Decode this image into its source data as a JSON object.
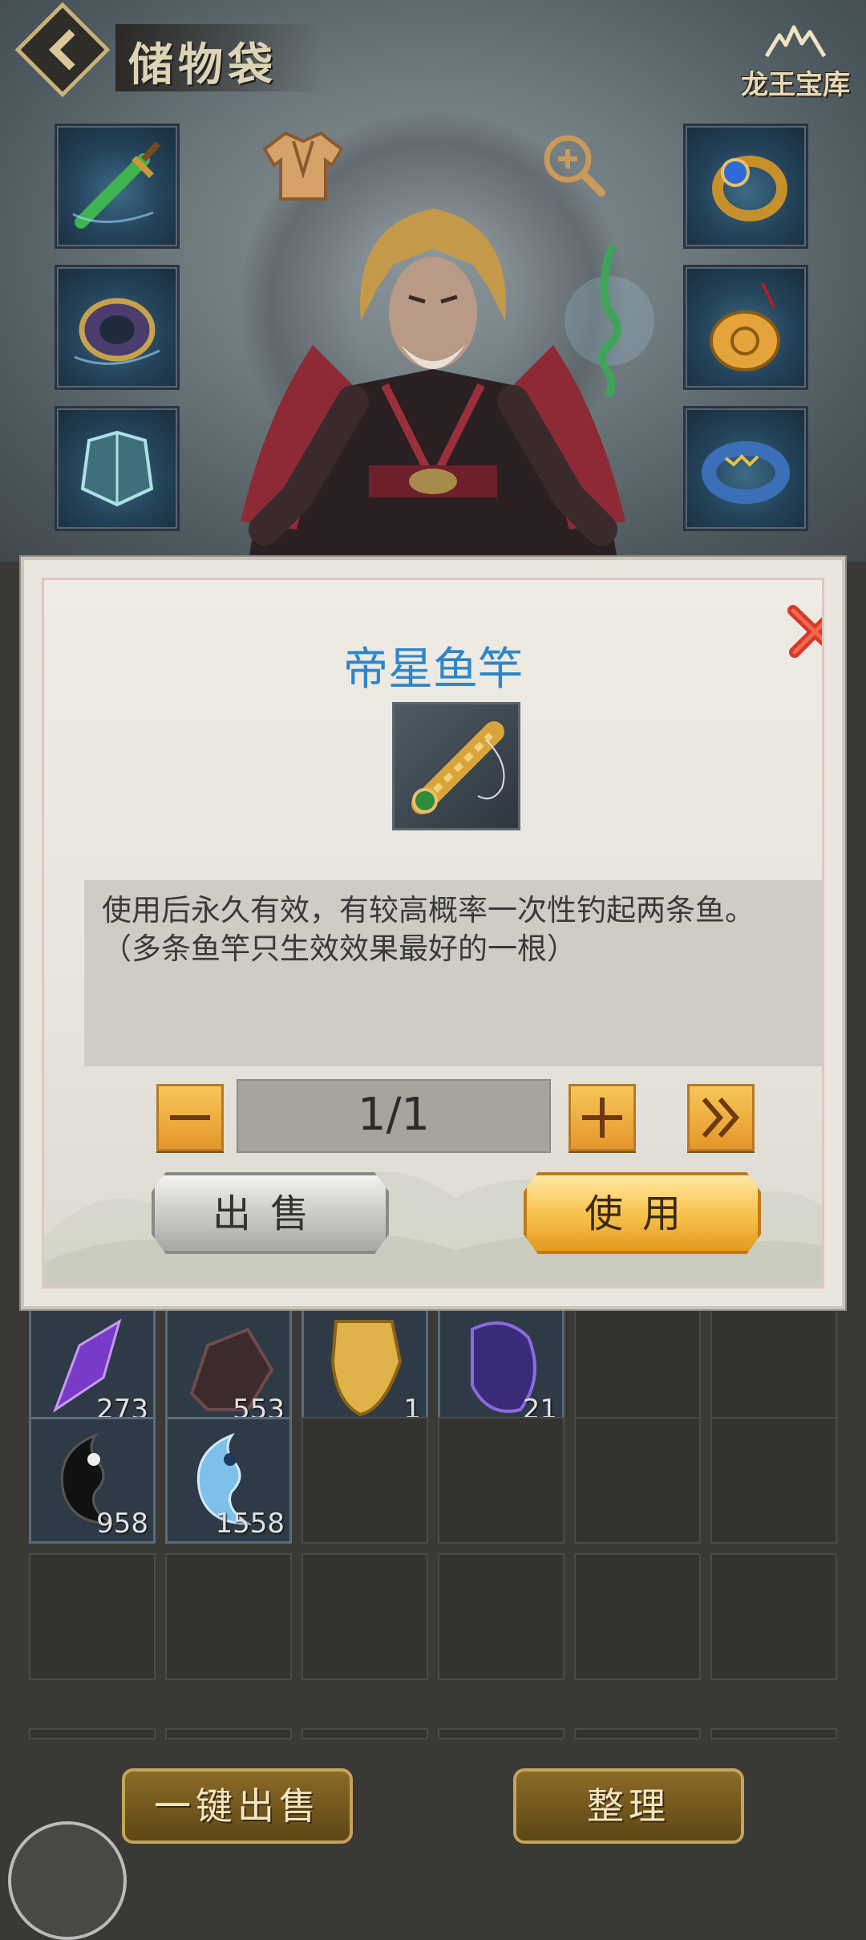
{
  "header": {
    "title": "储物袋",
    "logo_text": "龙王宝库"
  },
  "equipment": {
    "left_slots": [
      "sword-icon",
      "bracer-icon",
      "armor-icon"
    ],
    "right_slots": [
      "ring-icon",
      "pendant-icon",
      "band-icon"
    ]
  },
  "modal": {
    "item_name": "帝星鱼竿",
    "item_icon": "fishing-rod-icon",
    "description_line1": "使用后永久有效，有较高概率一次性钓起两条鱼。",
    "description_line2": "（多条鱼竿只生效效果最好的一根）",
    "quantity": "1/1",
    "sell_label": "出售",
    "use_label": "使用",
    "title_color": "#2f86c9"
  },
  "inventory": {
    "row1": [
      {
        "icon": "purple-crystal-icon",
        "count": "273"
      },
      {
        "icon": "dark-ore-icon",
        "count": "553"
      },
      {
        "icon": "golden-scroll-icon",
        "count": "1"
      },
      {
        "icon": "violet-shard-icon",
        "count": "21"
      }
    ],
    "row2": [
      {
        "icon": "yin-icon",
        "count": "958"
      },
      {
        "icon": "yang-icon",
        "count": "1558"
      }
    ]
  },
  "footer": {
    "sell_all_label": "一键出售",
    "sort_label": "整理"
  }
}
